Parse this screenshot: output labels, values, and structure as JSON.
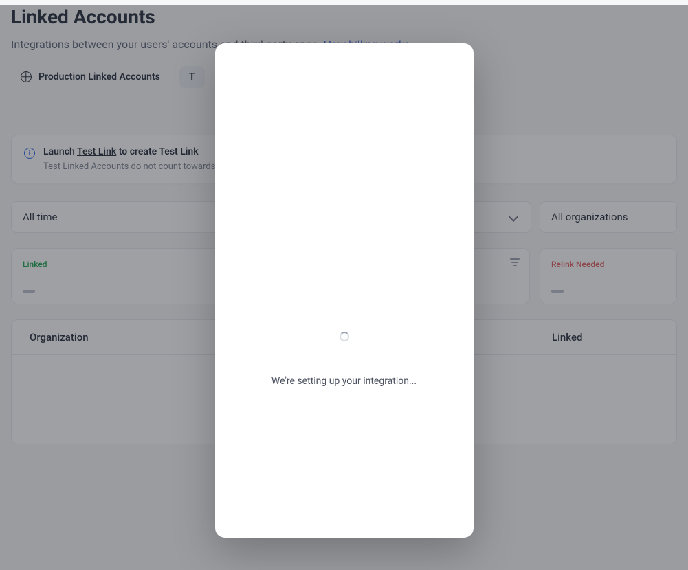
{
  "header": {
    "title": "Linked Accounts",
    "subtitle_prefix": "Integrations between your users' accounts and third-party apps. ",
    "billing_link": "How billing works"
  },
  "tabs": {
    "production": "Production Linked Accounts",
    "test_prefix": "T"
  },
  "banner": {
    "launch": "Launch ",
    "test_link": "Test Link",
    "title_suffix": " to create Test Link",
    "subtitle": "Test Linked Accounts do not count towards your billing quota and are displayed in the dashboard."
  },
  "filters": {
    "time": "All time",
    "orgs": "All organizations"
  },
  "cards": {
    "linked_label": "Linked",
    "relink_label": "Relink Needed"
  },
  "table": {
    "org": "Organization",
    "linked": "Linked"
  },
  "modal": {
    "message": "We're setting up your integration..."
  }
}
